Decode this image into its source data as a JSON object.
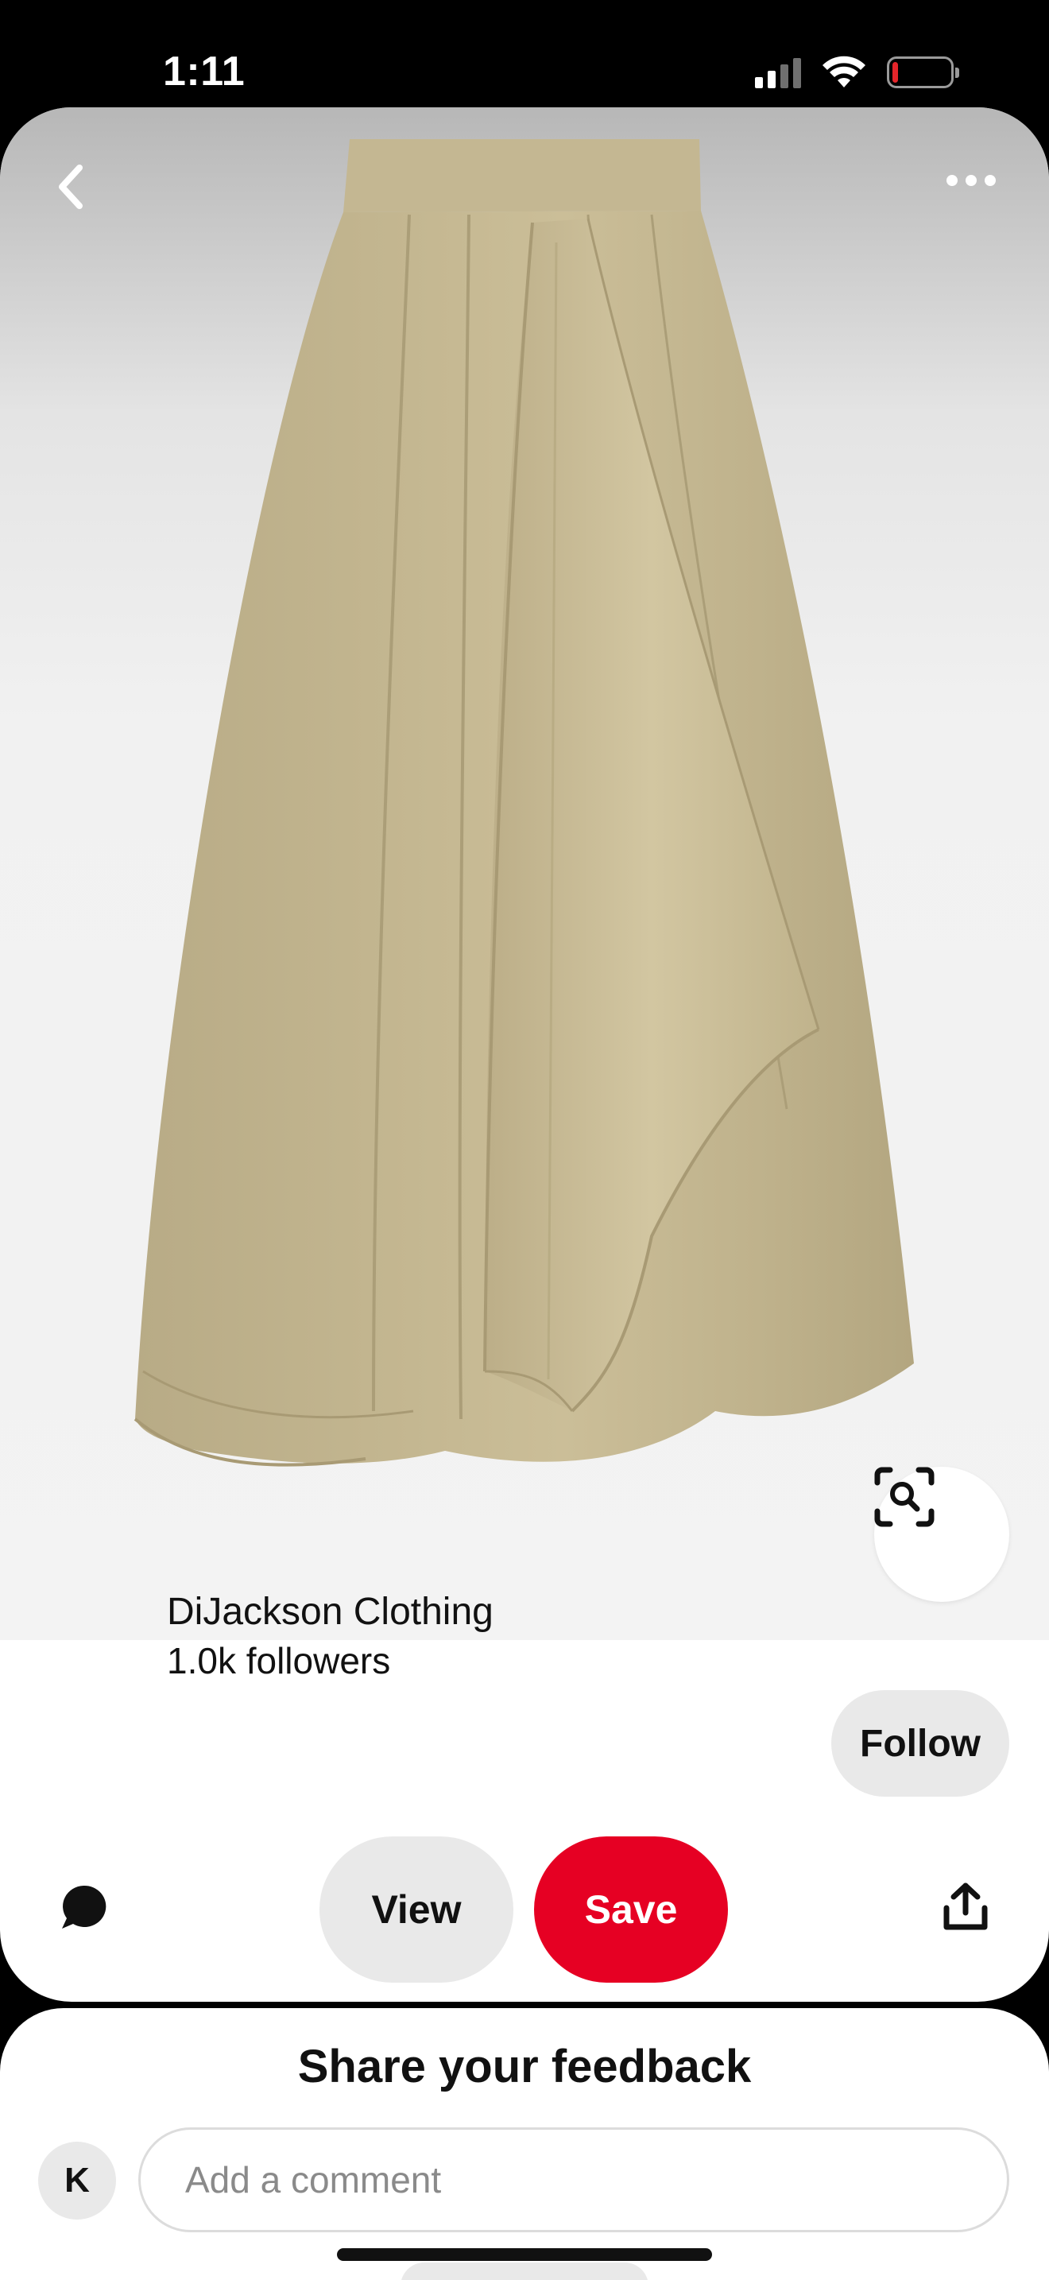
{
  "status_bar": {
    "time": "1:11",
    "icons": [
      "cellular-signal-icon",
      "wifi-icon",
      "battery-icon"
    ],
    "battery_level": 0.1,
    "battery_color": "#e5252a"
  },
  "pin": {
    "image_subject": "khaki pleated asymmetric midi skirt",
    "back_icon": "chevron-left-icon",
    "more_icon": "ellipsis-icon",
    "visual_search_icon": "visual-search-icon"
  },
  "creator": {
    "name": "DiJackson Clothing",
    "followers": "1.0k followers",
    "follow_label": "Follow"
  },
  "actions": {
    "comment_icon": "comment-bubble-icon",
    "view_label": "View",
    "save_label": "Save",
    "share_icon": "share-icon",
    "save_color": "#e60023"
  },
  "feedback": {
    "title": "Share your feedback",
    "avatar_initial": "K",
    "comment_placeholder": "Add a comment"
  }
}
